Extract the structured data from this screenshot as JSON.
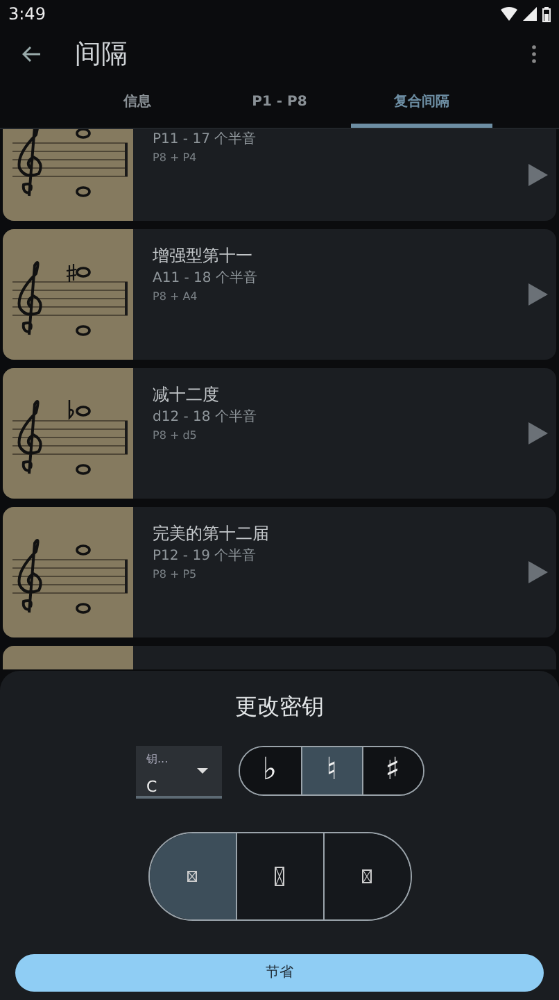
{
  "status_bar": {
    "time": "3:49"
  },
  "app_bar": {
    "title": "间隔"
  },
  "tabs": [
    {
      "label": "信息",
      "selected": false
    },
    {
      "label": "P1 - P8",
      "selected": false
    },
    {
      "label": "复合间隔",
      "selected": true
    }
  ],
  "intervals": [
    {
      "name": "P11 - 17 个半音",
      "formula": "P8 + P4",
      "kind": "plain"
    },
    {
      "title": "增强型第十一",
      "name": "A11 - 18 个半音",
      "formula": "P8 + A4",
      "kind": "sharp"
    },
    {
      "title": "减十二度",
      "name": "d12 - 18 个半音",
      "formula": "P8 + d5",
      "kind": "flat"
    },
    {
      "title": "完美的第十二届",
      "name": "P12 - 19 个半音",
      "formula": "P8 + P5",
      "kind": "plain"
    }
  ],
  "sheet": {
    "title": "更改密钥",
    "key_select": {
      "label": "钥...",
      "value": "C"
    },
    "accidentals": [
      {
        "symbol": "♭",
        "selected": false
      },
      {
        "symbol": "♮",
        "selected": true
      },
      {
        "symbol": "♯",
        "selected": false
      }
    ],
    "sizes": [
      {
        "selected": true
      },
      {
        "selected": false
      },
      {
        "selected": false
      }
    ],
    "save": "节省"
  }
}
